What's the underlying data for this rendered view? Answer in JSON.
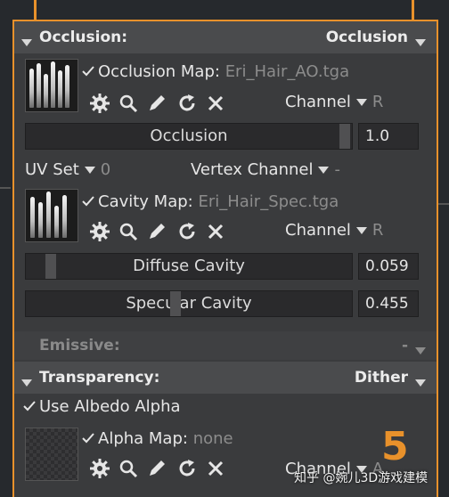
{
  "occlusion": {
    "header_title": "Occlusion:",
    "header_value": "Occlusion",
    "map_label": "Occlusion Map:",
    "map_file": "Eri_Hair_AO.tga",
    "channel_label": "Channel",
    "channel_value": "R",
    "slider_label": "Occlusion",
    "slider_value": "1.0",
    "slider_level": 1.0,
    "uv_set_label": "UV Set",
    "uv_set_value": "0",
    "vertex_channel_label": "Vertex Channel",
    "vertex_channel_value": "-",
    "cavity_map_label": "Cavity Map:",
    "cavity_map_file": "Eri_Hair_Spec.tga",
    "cavity_channel_label": "Channel",
    "cavity_channel_value": "R",
    "diffuse_cavity_label": "Diffuse Cavity",
    "diffuse_cavity_value": "0.059",
    "diffuse_cavity_level": 0.059,
    "specular_cavity_label": "Specular Cavity",
    "specular_cavity_value": "0.455",
    "specular_cavity_level": 0.455
  },
  "emissive": {
    "header_title": "Emissive:",
    "header_value": "-"
  },
  "transparency": {
    "header_title": "Transparency:",
    "header_value": "Dither",
    "use_albedo_alpha_label": "Use Albedo Alpha",
    "alpha_map_label": "Alpha Map:",
    "alpha_map_file": "none",
    "channel_label": "Channel",
    "channel_value": "A"
  },
  "overlay": {
    "step_number": "5",
    "watermark": "知乎 @婉儿3D游戏建模"
  },
  "colors": {
    "accent": "#e8912b",
    "panel_bg": "#3a3b3d",
    "header_bg": "#4a4b4d"
  },
  "icons": [
    "gear-icon",
    "search-icon",
    "pencil-icon",
    "reload-icon",
    "close-icon",
    "check-icon",
    "dropdown-triangle-icon"
  ]
}
